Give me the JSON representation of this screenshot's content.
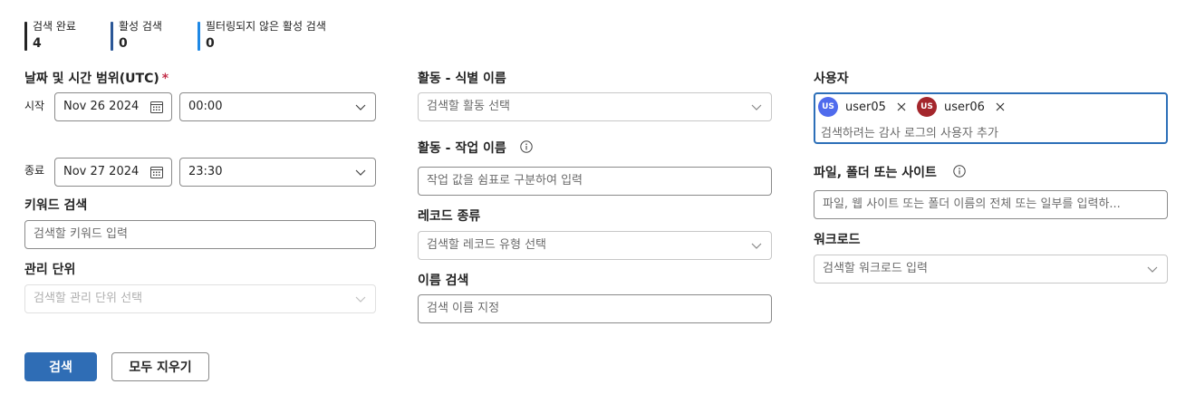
{
  "stats": [
    {
      "label": "검색 완료",
      "value": "4",
      "color": "#242424"
    },
    {
      "label": "활성 검색",
      "value": "0",
      "color": "#2b5797"
    },
    {
      "label": "필터링되지 않은 활성 검색",
      "value": "0",
      "color": "#1e88e5"
    }
  ],
  "date_range": {
    "label": "날짜 및 시간 범위(UTC)",
    "required_mark": "*",
    "start_label": "시작",
    "start_date": "Nov 26 2024",
    "start_time": "00:00",
    "end_label": "종료",
    "end_date": "Nov 27 2024",
    "end_time": "23:30"
  },
  "keyword": {
    "label": "키워드 검색",
    "placeholder": "검색할 키워드 입력"
  },
  "admin_unit": {
    "label": "관리 단위",
    "placeholder": "검색할 관리 단위 선택"
  },
  "activity_friendly": {
    "label": "활동 - 식별 이름",
    "placeholder": "검색할 활동 선택"
  },
  "activity_operation": {
    "label": "활동 - 작업 이름",
    "placeholder": "작업 값을 쉼표로 구분하여 입력"
  },
  "record_type": {
    "label": "레코드 종류",
    "placeholder": "검색할 레코드 유형 선택"
  },
  "search_name": {
    "label": "이름 검색",
    "placeholder": "검색 이름 지정"
  },
  "users": {
    "label": "사용자",
    "placeholder": "검색하려는 감사 로그의 사용자 추가",
    "chips": [
      {
        "initials": "US",
        "name": "user05",
        "color": "#4f6bed"
      },
      {
        "initials": "US",
        "name": "user06",
        "color": "#a4262c"
      }
    ]
  },
  "file_folder_site": {
    "label": "파일, 폴더 또는 사이트",
    "placeholder": "파일, 웹 사이트 또는 폴더 이름의 전체 또는 일부를 입력하..."
  },
  "workload": {
    "label": "워크로드",
    "placeholder": "검색할 워크로드 입력"
  },
  "buttons": {
    "search": "검색",
    "clear_all": "모두 지우기"
  }
}
